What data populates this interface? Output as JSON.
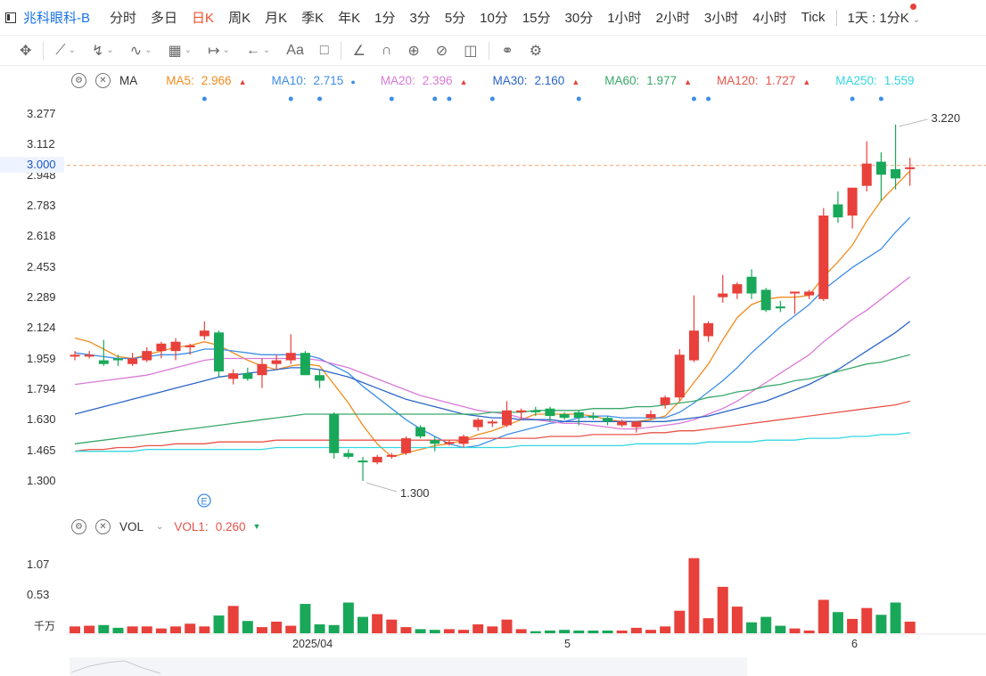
{
  "header": {
    "symbol": "兆科眼科-B",
    "periods": [
      "分时",
      "多日",
      "日K",
      "周K",
      "月K",
      "季K",
      "年K",
      "1分",
      "3分",
      "5分",
      "10分",
      "15分",
      "30分",
      "1小时",
      "2小时",
      "3小时",
      "4小时",
      "Tick"
    ],
    "active_period": "日K",
    "multi_period_label": "1天 : 1分K"
  },
  "toolbar": {
    "icons": [
      "move-icon",
      "line-tool-icon",
      "brush-icon",
      "wave-icon",
      "fib-icon",
      "measure-icon",
      "arrow-left-icon",
      "text-icon",
      "comment-icon",
      "pencil-icon",
      "magnet-icon",
      "eye-icon",
      "hide-icon",
      "trash-icon",
      "link-icon",
      "settings-icon"
    ],
    "text_tool_label": "Aa"
  },
  "ma_indicator": {
    "name": "MA",
    "items": [
      {
        "label": "MA5:",
        "value": "2.966",
        "color": "#f08c1e",
        "dir": "up"
      },
      {
        "label": "MA10:",
        "value": "2.715",
        "color": "#3d8ee8",
        "dir": "dot"
      },
      {
        "label": "MA20:",
        "value": "2.396",
        "color": "#d97ad6",
        "dir": "up"
      },
      {
        "label": "MA30:",
        "value": "2.160",
        "color": "#2a65c7",
        "dir": "up"
      },
      {
        "label": "MA60:",
        "value": "1.977",
        "color": "#3aa86a",
        "dir": "up"
      },
      {
        "label": "MA120:",
        "value": "1.727",
        "color": "#e8544a",
        "dir": "up"
      },
      {
        "label": "MA250:",
        "value": "1.559",
        "color": "#33d6e0",
        "dir": "none"
      }
    ]
  },
  "price_axis": {
    "labels": [
      "3.277",
      "3.112",
      "2.948",
      "2.783",
      "2.618",
      "2.453",
      "2.289",
      "2.124",
      "1.959",
      "1.794",
      "1.630",
      "1.465",
      "1.300"
    ],
    "current_price": "3.000",
    "high_marker": "3.220",
    "low_marker": "1.300",
    "event_marker": "E"
  },
  "volume_indicator": {
    "name": "VOL",
    "label": "VOL1:",
    "value": "0.260",
    "axis_labels": [
      "1.07",
      "0.53"
    ],
    "unit": "千万"
  },
  "x_axis": {
    "labels": [
      "2025/04",
      "5",
      "6"
    ]
  },
  "colors": {
    "up": "#e8403a",
    "down": "#19a85a",
    "accent": "#f0502a",
    "link": "#1a73e8"
  },
  "candles": [
    {
      "o": 1.97,
      "h": 2.0,
      "l": 1.95,
      "c": 1.98
    },
    {
      "o": 1.97,
      "h": 2.0,
      "l": 1.96,
      "c": 1.98
    },
    {
      "o": 1.95,
      "h": 2.06,
      "l": 1.92,
      "c": 1.93
    },
    {
      "o": 1.96,
      "h": 1.98,
      "l": 1.92,
      "c": 1.95
    },
    {
      "o": 1.93,
      "h": 1.99,
      "l": 1.92,
      "c": 1.96
    },
    {
      "o": 1.95,
      "h": 2.02,
      "l": 1.94,
      "c": 2.0
    },
    {
      "o": 2.0,
      "h": 2.05,
      "l": 1.96,
      "c": 2.04
    },
    {
      "o": 2.0,
      "h": 2.07,
      "l": 1.95,
      "c": 2.05
    },
    {
      "o": 2.02,
      "h": 2.04,
      "l": 1.98,
      "c": 2.03
    },
    {
      "o": 2.08,
      "h": 2.16,
      "l": 2.06,
      "c": 2.11
    },
    {
      "o": 2.1,
      "h": 2.11,
      "l": 1.86,
      "c": 1.89
    },
    {
      "o": 1.85,
      "h": 1.9,
      "l": 1.82,
      "c": 1.88
    },
    {
      "o": 1.88,
      "h": 1.91,
      "l": 1.84,
      "c": 1.85
    },
    {
      "o": 1.87,
      "h": 1.96,
      "l": 1.8,
      "c": 1.93
    },
    {
      "o": 1.93,
      "h": 1.98,
      "l": 1.9,
      "c": 1.95
    },
    {
      "o": 1.95,
      "h": 2.09,
      "l": 1.93,
      "c": 1.99
    },
    {
      "o": 1.99,
      "h": 2.0,
      "l": 1.87,
      "c": 1.87
    },
    {
      "o": 1.87,
      "h": 1.9,
      "l": 1.8,
      "c": 1.84
    },
    {
      "o": 1.66,
      "h": 1.67,
      "l": 1.42,
      "c": 1.45
    },
    {
      "o": 1.45,
      "h": 1.47,
      "l": 1.42,
      "c": 1.43
    },
    {
      "o": 1.41,
      "h": 1.43,
      "l": 1.3,
      "c": 1.4
    },
    {
      "o": 1.4,
      "h": 1.44,
      "l": 1.39,
      "c": 1.43
    },
    {
      "o": 1.43,
      "h": 1.45,
      "l": 1.42,
      "c": 1.44
    },
    {
      "o": 1.45,
      "h": 1.54,
      "l": 1.44,
      "c": 1.53
    },
    {
      "o": 1.59,
      "h": 1.6,
      "l": 1.53,
      "c": 1.54
    },
    {
      "o": 1.52,
      "h": 1.54,
      "l": 1.46,
      "c": 1.5
    },
    {
      "o": 1.51,
      "h": 1.52,
      "l": 1.49,
      "c": 1.51
    },
    {
      "o": 1.5,
      "h": 1.55,
      "l": 1.48,
      "c": 1.54
    },
    {
      "o": 1.59,
      "h": 1.64,
      "l": 1.57,
      "c": 1.63
    },
    {
      "o": 1.61,
      "h": 1.63,
      "l": 1.59,
      "c": 1.62
    },
    {
      "o": 1.6,
      "h": 1.73,
      "l": 1.59,
      "c": 1.68
    },
    {
      "o": 1.67,
      "h": 1.69,
      "l": 1.63,
      "c": 1.68
    },
    {
      "o": 1.68,
      "h": 1.7,
      "l": 1.65,
      "c": 1.67
    },
    {
      "o": 1.69,
      "h": 1.7,
      "l": 1.62,
      "c": 1.65
    },
    {
      "o": 1.66,
      "h": 1.67,
      "l": 1.63,
      "c": 1.64
    },
    {
      "o": 1.67,
      "h": 1.68,
      "l": 1.6,
      "c": 1.64
    },
    {
      "o": 1.65,
      "h": 1.67,
      "l": 1.63,
      "c": 1.64
    },
    {
      "o": 1.64,
      "h": 1.65,
      "l": 1.6,
      "c": 1.62
    },
    {
      "o": 1.6,
      "h": 1.63,
      "l": 1.59,
      "c": 1.62
    },
    {
      "o": 1.59,
      "h": 1.62,
      "l": 1.56,
      "c": 1.62
    },
    {
      "o": 1.64,
      "h": 1.68,
      "l": 1.63,
      "c": 1.66
    },
    {
      "o": 1.71,
      "h": 1.76,
      "l": 1.69,
      "c": 1.75
    },
    {
      "o": 1.75,
      "h": 2.01,
      "l": 1.73,
      "c": 1.98
    },
    {
      "o": 1.95,
      "h": 2.3,
      "l": 1.94,
      "c": 2.11
    },
    {
      "o": 2.08,
      "h": 2.16,
      "l": 2.05,
      "c": 2.15
    },
    {
      "o": 2.29,
      "h": 2.41,
      "l": 2.26,
      "c": 2.31
    },
    {
      "o": 2.31,
      "h": 2.37,
      "l": 2.28,
      "c": 2.36
    },
    {
      "o": 2.4,
      "h": 2.44,
      "l": 2.28,
      "c": 2.31
    },
    {
      "o": 2.33,
      "h": 2.34,
      "l": 2.21,
      "c": 2.22
    },
    {
      "o": 2.24,
      "h": 2.27,
      "l": 2.21,
      "c": 2.23
    },
    {
      "o": 2.31,
      "h": 2.32,
      "l": 2.2,
      "c": 2.32
    },
    {
      "o": 2.3,
      "h": 2.33,
      "l": 2.28,
      "c": 2.32
    },
    {
      "o": 2.28,
      "h": 2.77,
      "l": 2.27,
      "c": 2.73
    },
    {
      "o": 2.79,
      "h": 2.86,
      "l": 2.69,
      "c": 2.72
    },
    {
      "o": 2.73,
      "h": 2.88,
      "l": 2.66,
      "c": 2.88
    },
    {
      "o": 2.89,
      "h": 3.13,
      "l": 2.86,
      "c": 3.01
    },
    {
      "o": 3.02,
      "h": 3.07,
      "l": 2.81,
      "c": 2.95
    },
    {
      "o": 2.98,
      "h": 3.22,
      "l": 2.87,
      "c": 2.93
    },
    {
      "o": 2.98,
      "h": 3.04,
      "l": 2.89,
      "c": 2.99
    }
  ],
  "volumes": [
    0.1,
    0.11,
    0.12,
    0.08,
    0.1,
    0.1,
    0.07,
    0.1,
    0.14,
    0.1,
    0.26,
    0.4,
    0.18,
    0.09,
    0.17,
    0.11,
    0.43,
    0.13,
    0.12,
    0.45,
    0.24,
    0.28,
    0.2,
    0.09,
    0.06,
    0.05,
    0.06,
    0.05,
    0.13,
    0.1,
    0.2,
    0.06,
    0.03,
    0.04,
    0.05,
    0.04,
    0.04,
    0.04,
    0.04,
    0.08,
    0.05,
    0.1,
    0.33,
    1.1,
    0.22,
    0.68,
    0.39,
    0.16,
    0.24,
    0.11,
    0.07,
    0.04,
    0.49,
    0.31,
    0.21,
    0.37,
    0.27,
    0.45,
    0.17
  ],
  "ma_lines": {
    "ma5": [
      2.07,
      2.05,
      2.01,
      1.97,
      1.96,
      1.98,
      2.0,
      2.02,
      2.03,
      2.05,
      2.03,
      1.99,
      1.95,
      1.92,
      1.9,
      1.92,
      1.93,
      1.92,
      1.82,
      1.72,
      1.6,
      1.5,
      1.43,
      1.45,
      1.47,
      1.49,
      1.5,
      1.52,
      1.55,
      1.57,
      1.6,
      1.63,
      1.66,
      1.66,
      1.66,
      1.66,
      1.65,
      1.63,
      1.62,
      1.62,
      1.63,
      1.65,
      1.73,
      1.83,
      1.93,
      2.06,
      2.18,
      2.25,
      2.28,
      2.29,
      2.29,
      2.3,
      2.4,
      2.48,
      2.57,
      2.7,
      2.81,
      2.89,
      2.97
    ],
    "ma10": [
      1.99,
      1.98,
      1.97,
      1.96,
      1.96,
      1.97,
      1.98,
      1.98,
      1.99,
      2.01,
      2.01,
      2.0,
      1.99,
      1.98,
      1.98,
      1.98,
      1.98,
      1.96,
      1.92,
      1.88,
      1.81,
      1.75,
      1.69,
      1.63,
      1.58,
      1.54,
      1.5,
      1.48,
      1.49,
      1.52,
      1.55,
      1.57,
      1.59,
      1.61,
      1.62,
      1.64,
      1.65,
      1.65,
      1.64,
      1.64,
      1.64,
      1.64,
      1.67,
      1.72,
      1.78,
      1.84,
      1.91,
      1.99,
      2.06,
      2.13,
      2.19,
      2.25,
      2.33,
      2.39,
      2.45,
      2.5,
      2.55,
      2.64,
      2.72
    ],
    "ma20": [
      1.82,
      1.83,
      1.84,
      1.85,
      1.86,
      1.87,
      1.89,
      1.91,
      1.93,
      1.95,
      1.96,
      1.96,
      1.96,
      1.96,
      1.96,
      1.96,
      1.96,
      1.95,
      1.93,
      1.91,
      1.88,
      1.85,
      1.82,
      1.79,
      1.76,
      1.74,
      1.72,
      1.7,
      1.68,
      1.67,
      1.66,
      1.64,
      1.63,
      1.62,
      1.61,
      1.61,
      1.6,
      1.59,
      1.58,
      1.58,
      1.59,
      1.6,
      1.61,
      1.63,
      1.66,
      1.69,
      1.73,
      1.78,
      1.83,
      1.88,
      1.93,
      1.98,
      2.05,
      2.11,
      2.17,
      2.22,
      2.28,
      2.34,
      2.4
    ],
    "ma30": [
      1.66,
      1.68,
      1.7,
      1.72,
      1.74,
      1.76,
      1.78,
      1.8,
      1.82,
      1.84,
      1.86,
      1.87,
      1.88,
      1.89,
      1.9,
      1.91,
      1.91,
      1.9,
      1.88,
      1.86,
      1.83,
      1.8,
      1.77,
      1.74,
      1.72,
      1.7,
      1.68,
      1.66,
      1.65,
      1.64,
      1.64,
      1.63,
      1.63,
      1.63,
      1.62,
      1.62,
      1.62,
      1.62,
      1.62,
      1.62,
      1.62,
      1.62,
      1.63,
      1.64,
      1.65,
      1.67,
      1.69,
      1.71,
      1.73,
      1.76,
      1.79,
      1.82,
      1.86,
      1.9,
      1.95,
      2.0,
      2.05,
      2.1,
      2.16
    ],
    "ma60": [
      1.5,
      1.51,
      1.52,
      1.53,
      1.54,
      1.55,
      1.56,
      1.57,
      1.58,
      1.59,
      1.6,
      1.61,
      1.62,
      1.63,
      1.64,
      1.65,
      1.66,
      1.66,
      1.66,
      1.66,
      1.66,
      1.66,
      1.66,
      1.66,
      1.66,
      1.66,
      1.66,
      1.66,
      1.66,
      1.67,
      1.67,
      1.67,
      1.68,
      1.68,
      1.68,
      1.68,
      1.69,
      1.69,
      1.69,
      1.7,
      1.7,
      1.71,
      1.72,
      1.73,
      1.75,
      1.76,
      1.78,
      1.79,
      1.81,
      1.82,
      1.84,
      1.85,
      1.87,
      1.89,
      1.91,
      1.93,
      1.94,
      1.96,
      1.98
    ],
    "ma120": [
      1.46,
      1.47,
      1.47,
      1.48,
      1.48,
      1.49,
      1.49,
      1.5,
      1.5,
      1.5,
      1.51,
      1.51,
      1.51,
      1.51,
      1.52,
      1.52,
      1.52,
      1.52,
      1.52,
      1.52,
      1.52,
      1.52,
      1.52,
      1.52,
      1.52,
      1.52,
      1.52,
      1.52,
      1.53,
      1.53,
      1.53,
      1.53,
      1.53,
      1.54,
      1.54,
      1.54,
      1.55,
      1.55,
      1.55,
      1.55,
      1.56,
      1.56,
      1.57,
      1.57,
      1.58,
      1.59,
      1.6,
      1.61,
      1.62,
      1.63,
      1.64,
      1.65,
      1.66,
      1.67,
      1.68,
      1.69,
      1.7,
      1.71,
      1.73
    ],
    "ma250": [
      1.46,
      1.46,
      1.46,
      1.46,
      1.46,
      1.47,
      1.47,
      1.47,
      1.47,
      1.47,
      1.47,
      1.47,
      1.47,
      1.47,
      1.48,
      1.48,
      1.48,
      1.48,
      1.48,
      1.48,
      1.48,
      1.48,
      1.48,
      1.48,
      1.48,
      1.48,
      1.48,
      1.48,
      1.48,
      1.48,
      1.48,
      1.49,
      1.49,
      1.49,
      1.49,
      1.49,
      1.49,
      1.49,
      1.49,
      1.5,
      1.5,
      1.5,
      1.5,
      1.5,
      1.51,
      1.51,
      1.51,
      1.51,
      1.52,
      1.52,
      1.52,
      1.53,
      1.53,
      1.53,
      1.54,
      1.54,
      1.55,
      1.55,
      1.56
    ]
  }
}
